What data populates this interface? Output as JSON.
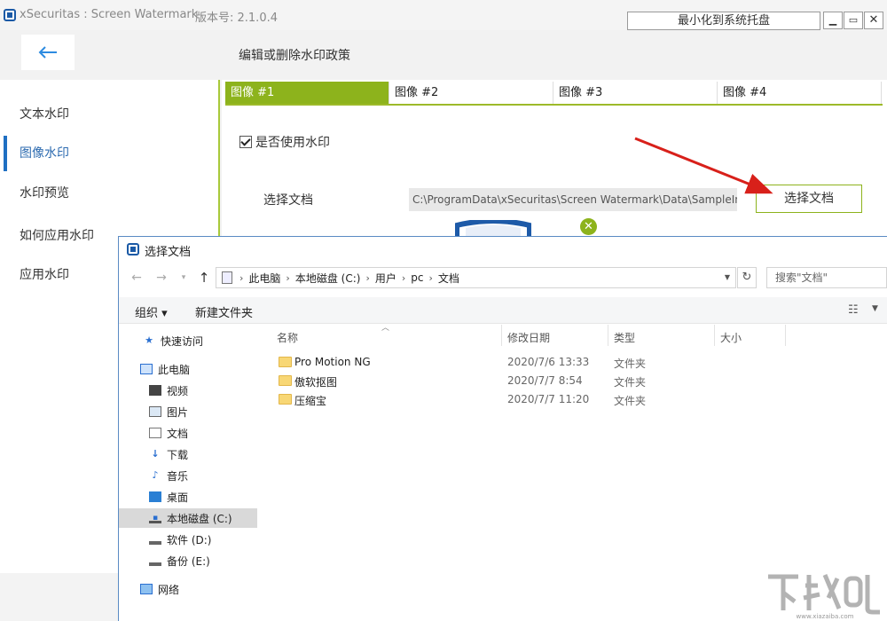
{
  "app": {
    "title": "xSecuritas : Screen Watermark",
    "version": "版本号: 2.1.0.4",
    "tray_button": "最小化到系统托盘",
    "min": "▁",
    "max": "▭",
    "close": "✕"
  },
  "page_header": "编辑或删除水印政策",
  "sidebar": {
    "items": [
      {
        "label": "文本水印"
      },
      {
        "label": "图像水印"
      },
      {
        "label": "水印预览"
      },
      {
        "label": "如何应用水印"
      },
      {
        "label": "应用水印"
      }
    ],
    "active_index": 1
  },
  "tabs": [
    {
      "label": "图像 #1"
    },
    {
      "label": "图像 #2"
    },
    {
      "label": "图像 #3"
    },
    {
      "label": "图像 #4"
    }
  ],
  "image_panel": {
    "use_watermark_label": "是否使用水印",
    "use_watermark_checked": true,
    "select_doc_label": "选择文档",
    "doc_path": "C:\\ProgramData\\xSecuritas\\Screen Watermark\\Data\\SampleIm",
    "select_doc_button": "选择文档",
    "clear_symbol": "✕"
  },
  "dialog": {
    "title": "选择文档",
    "breadcrumbs": [
      "此电脑",
      "本地磁盘 (C:)",
      "用户",
      "pc",
      "文档"
    ],
    "search_placeholder": "搜索\"文档\"",
    "organize": "组织 ▾",
    "new_folder": "新建文件夹",
    "nav_items": [
      {
        "label": "快速访问",
        "icon": "star-icon"
      },
      {
        "label": "此电脑",
        "icon": "computer-icon"
      },
      {
        "label": "视频",
        "icon": "video-icon"
      },
      {
        "label": "图片",
        "icon": "picture-icon"
      },
      {
        "label": "文档",
        "icon": "document-icon"
      },
      {
        "label": "下载",
        "icon": "download-icon"
      },
      {
        "label": "音乐",
        "icon": "music-icon"
      },
      {
        "label": "桌面",
        "icon": "desktop-icon"
      },
      {
        "label": "本地磁盘 (C:)",
        "icon": "drive-icon"
      },
      {
        "label": "软件 (D:)",
        "icon": "drive-icon"
      },
      {
        "label": "备份 (E:)",
        "icon": "drive-icon"
      },
      {
        "label": "网络",
        "icon": "network-icon"
      }
    ],
    "selected_nav": "本地磁盘 (C:)",
    "columns": {
      "name": "名称",
      "modified": "修改日期",
      "type": "类型",
      "size": "大小"
    },
    "files": [
      {
        "name": "Pro Motion NG",
        "modified": "2020/7/6 13:33",
        "type": "文件夹"
      },
      {
        "name": "傲软抠图",
        "modified": "2020/7/7 8:54",
        "type": "文件夹"
      },
      {
        "name": "压缩宝",
        "modified": "2020/7/7 11:20",
        "type": "文件夹"
      }
    ]
  },
  "colors": {
    "accent_green": "#8db31c",
    "accent_blue": "#1f6fc2",
    "arrow_red": "#d8201a"
  }
}
